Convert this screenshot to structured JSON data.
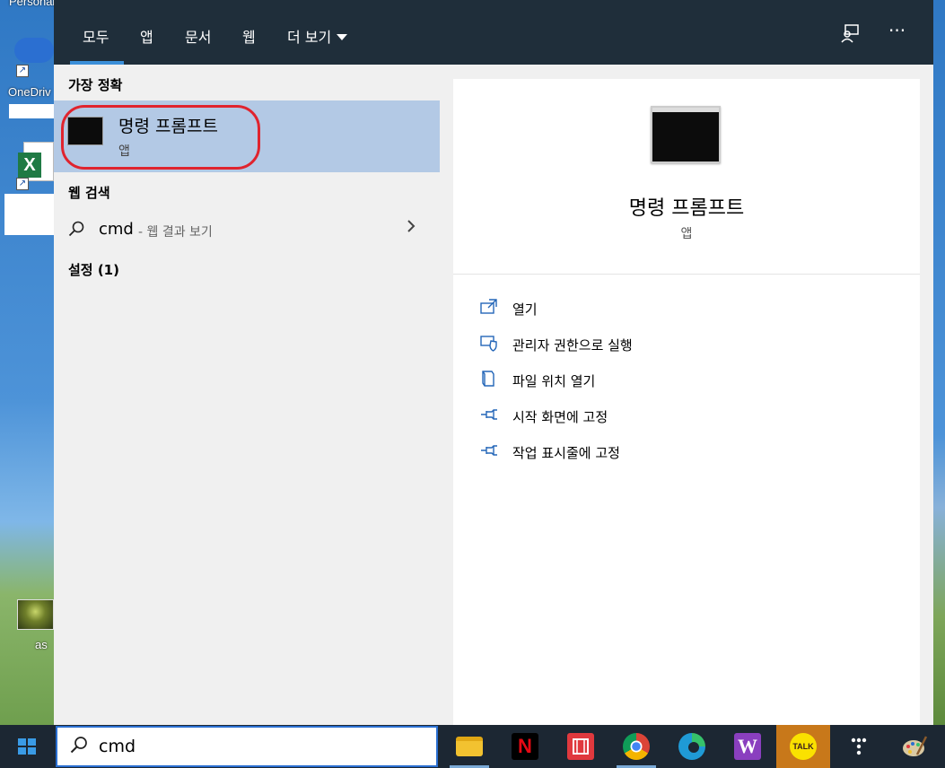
{
  "desktop": {
    "top_label": "Personal ...",
    "onedrive_label": "OneDriv",
    "photo_label": "as"
  },
  "tabs": [
    {
      "label": "모두"
    },
    {
      "label": "앱"
    },
    {
      "label": "문서"
    },
    {
      "label": "웹"
    },
    {
      "label": "더 보기"
    }
  ],
  "sections": {
    "best_match": "가장 정확",
    "web_search": "웹 검색",
    "settings": "설정 (1)"
  },
  "best_match_item": {
    "title": "명령 프롬프트",
    "subtitle": "앱"
  },
  "web_result": {
    "query": "cmd",
    "hint": "- 웹 결과 보기"
  },
  "preview": {
    "title": "명령 프롬프트",
    "subtitle": "앱"
  },
  "actions": [
    {
      "label": "열기",
      "icon": "open-icon"
    },
    {
      "label": "관리자 권한으로 실행",
      "icon": "shield-icon"
    },
    {
      "label": "파일 위치 열기",
      "icon": "file-location-icon"
    },
    {
      "label": "시작 화면에 고정",
      "icon": "pin-icon"
    },
    {
      "label": "작업 표시줄에 고정",
      "icon": "pin-icon"
    }
  ],
  "taskbar": {
    "search_value": "cmd",
    "apps": [
      {
        "name": "file-explorer-icon",
        "color": "#f2c230"
      },
      {
        "name": "netflix-icon",
        "color": "#000000",
        "text": "N"
      },
      {
        "name": "video-editor-icon",
        "color": "#e0393e"
      },
      {
        "name": "chrome-icon",
        "color": "#4285f4"
      },
      {
        "name": "edge-icon",
        "color": "#1f9ad6"
      },
      {
        "name": "w-app-icon",
        "color": "#8a3fbf",
        "text": "W"
      },
      {
        "name": "kakaotalk-icon",
        "color": "#fae100",
        "text": "TALK"
      },
      {
        "name": "dots-app-icon",
        "color": "#000000"
      },
      {
        "name": "paint-icon",
        "color": "#d9c9a3"
      }
    ]
  },
  "colors": {
    "topbar": "#1f2e3a",
    "accent": "#3b8fd9",
    "selection": "#b3c9e5",
    "highlight_ring": "#e0242e"
  }
}
